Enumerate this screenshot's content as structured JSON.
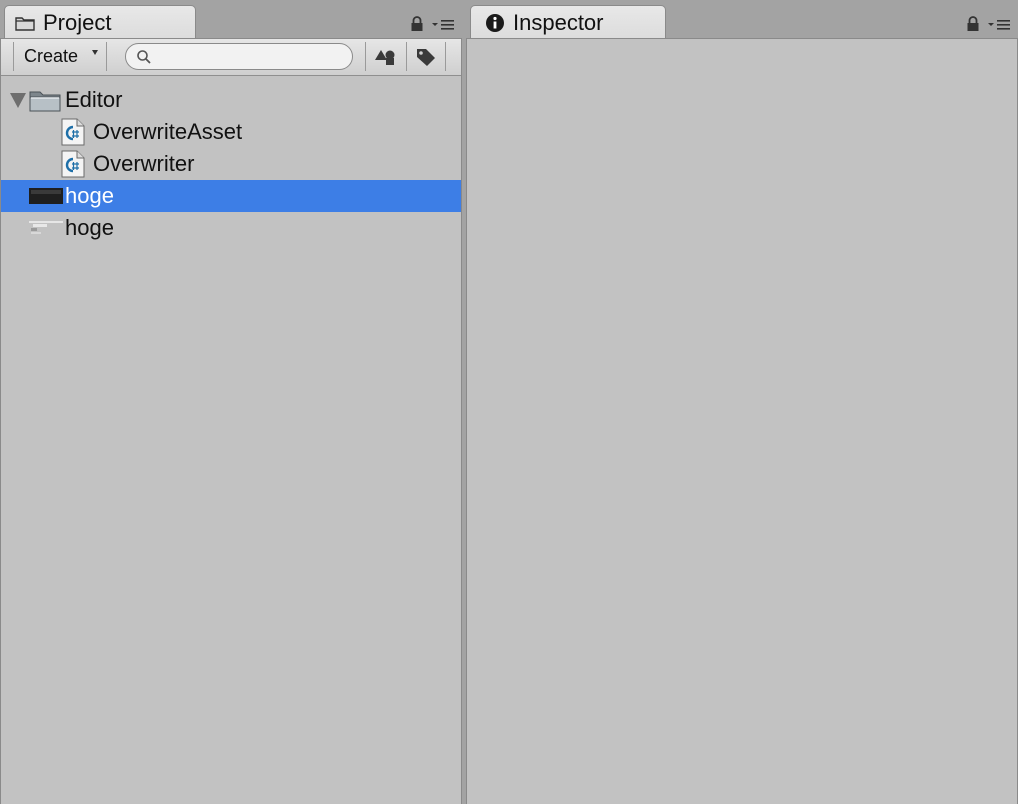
{
  "project_panel": {
    "tab_title": "Project",
    "toolbar": {
      "create_label": "Create",
      "search_placeholder": "",
      "search_value": ""
    },
    "tree": [
      {
        "label": "Editor",
        "type": "folder",
        "expanded": true,
        "depth": 0
      },
      {
        "label": "OverwriteAsset",
        "type": "csharp-script",
        "depth": 1
      },
      {
        "label": "Overwriter",
        "type": "csharp-script",
        "depth": 1
      },
      {
        "label": "hoge",
        "type": "asset-dark",
        "depth": 0,
        "selected": true
      },
      {
        "label": "hoge",
        "type": "asset-light",
        "depth": 0
      }
    ]
  },
  "inspector_panel": {
    "tab_title": "Inspector"
  },
  "colors": {
    "selection": "#3d7ee6",
    "panel_bg": "#c2c2c2",
    "tab_bg": "#e0e0e0"
  }
}
